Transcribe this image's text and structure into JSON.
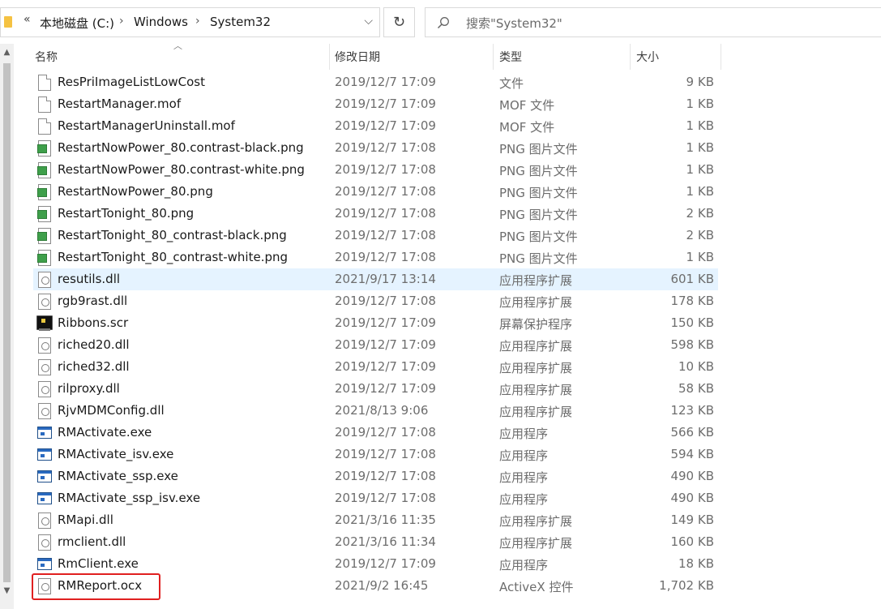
{
  "address_bar": {
    "overflow_label": "«",
    "breadcrumbs": [
      "本地磁盘 (C:)",
      "Windows",
      "System32"
    ],
    "separator": "›",
    "dropdown_label": "⌵"
  },
  "refresh_label": "↻",
  "search": {
    "placeholder": "搜索\"System32\""
  },
  "columns": {
    "name": "名称",
    "date": "修改日期",
    "type": "类型",
    "size": "大小"
  },
  "files": [
    {
      "name": "ResPriImageListLowCost",
      "date": "2019/12/7 17:09",
      "type": "文件",
      "size": "9 KB",
      "icon": "file-icon"
    },
    {
      "name": "RestartManager.mof",
      "date": "2019/12/7 17:09",
      "type": "MOF 文件",
      "size": "1 KB",
      "icon": "file-icon"
    },
    {
      "name": "RestartManagerUninstall.mof",
      "date": "2019/12/7 17:09",
      "type": "MOF 文件",
      "size": "1 KB",
      "icon": "file-icon"
    },
    {
      "name": "RestartNowPower_80.contrast-black.png",
      "date": "2019/12/7 17:08",
      "type": "PNG 图片文件",
      "size": "1 KB",
      "icon": "png-icon"
    },
    {
      "name": "RestartNowPower_80.contrast-white.png",
      "date": "2019/12/7 17:08",
      "type": "PNG 图片文件",
      "size": "1 KB",
      "icon": "png-icon"
    },
    {
      "name": "RestartNowPower_80.png",
      "date": "2019/12/7 17:08",
      "type": "PNG 图片文件",
      "size": "1 KB",
      "icon": "png-icon"
    },
    {
      "name": "RestartTonight_80.png",
      "date": "2019/12/7 17:08",
      "type": "PNG 图片文件",
      "size": "2 KB",
      "icon": "png-icon"
    },
    {
      "name": "RestartTonight_80_contrast-black.png",
      "date": "2019/12/7 17:08",
      "type": "PNG 图片文件",
      "size": "2 KB",
      "icon": "png-icon"
    },
    {
      "name": "RestartTonight_80_contrast-white.png",
      "date": "2019/12/7 17:08",
      "type": "PNG 图片文件",
      "size": "1 KB",
      "icon": "png-icon"
    },
    {
      "name": "resutils.dll",
      "date": "2021/9/17 13:14",
      "type": "应用程序扩展",
      "size": "601 KB",
      "icon": "dll-icon",
      "selected": true
    },
    {
      "name": "rgb9rast.dll",
      "date": "2019/12/7 17:08",
      "type": "应用程序扩展",
      "size": "178 KB",
      "icon": "dll-icon"
    },
    {
      "name": "Ribbons.scr",
      "date": "2019/12/7 17:09",
      "type": "屏幕保护程序",
      "size": "150 KB",
      "icon": "screensaver-icon"
    },
    {
      "name": "riched20.dll",
      "date": "2019/12/7 17:09",
      "type": "应用程序扩展",
      "size": "598 KB",
      "icon": "dll-icon"
    },
    {
      "name": "riched32.dll",
      "date": "2019/12/7 17:09",
      "type": "应用程序扩展",
      "size": "10 KB",
      "icon": "dll-icon"
    },
    {
      "name": "rilproxy.dll",
      "date": "2019/12/7 17:09",
      "type": "应用程序扩展",
      "size": "58 KB",
      "icon": "dll-icon"
    },
    {
      "name": "RjvMDMConfig.dll",
      "date": "2021/8/13 9:06",
      "type": "应用程序扩展",
      "size": "123 KB",
      "icon": "dll-icon"
    },
    {
      "name": "RMActivate.exe",
      "date": "2019/12/7 17:08",
      "type": "应用程序",
      "size": "566 KB",
      "icon": "exe-icon"
    },
    {
      "name": "RMActivate_isv.exe",
      "date": "2019/12/7 17:08",
      "type": "应用程序",
      "size": "594 KB",
      "icon": "exe-icon"
    },
    {
      "name": "RMActivate_ssp.exe",
      "date": "2019/12/7 17:08",
      "type": "应用程序",
      "size": "490 KB",
      "icon": "exe-icon"
    },
    {
      "name": "RMActivate_ssp_isv.exe",
      "date": "2019/12/7 17:08",
      "type": "应用程序",
      "size": "490 KB",
      "icon": "exe-icon"
    },
    {
      "name": "RMapi.dll",
      "date": "2021/3/16 11:35",
      "type": "应用程序扩展",
      "size": "149 KB",
      "icon": "dll-icon"
    },
    {
      "name": "rmclient.dll",
      "date": "2021/3/16 11:34",
      "type": "应用程序扩展",
      "size": "160 KB",
      "icon": "dll-icon"
    },
    {
      "name": "RmClient.exe",
      "date": "2019/12/7 17:09",
      "type": "应用程序",
      "size": "18 KB",
      "icon": "exe-icon"
    },
    {
      "name": "RMReport.ocx",
      "date": "2021/9/2 16:45",
      "type": "ActiveX 控件",
      "size": "1,702 KB",
      "icon": "dll-icon",
      "highlighted": true
    }
  ],
  "colors": {
    "selected_row": "#e5f3ff",
    "highlight_border": "#e02020"
  }
}
